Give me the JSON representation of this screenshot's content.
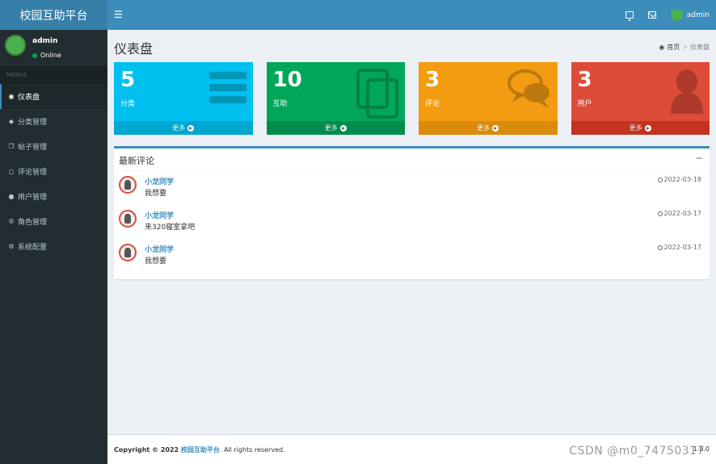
{
  "app": {
    "title": "校园互助平台"
  },
  "topbar": {
    "user_name": "admin",
    "icons": [
      "monitor-icon",
      "mail-icon"
    ]
  },
  "sidebar": {
    "user": {
      "name": "admin",
      "status": "Online"
    },
    "menu_header": "MENUS",
    "items": [
      {
        "label": "仪表盘",
        "icon": "dashboard-icon"
      },
      {
        "label": "分类管理",
        "icon": "tag-icon"
      },
      {
        "label": "帖子管理",
        "icon": "copy-icon"
      },
      {
        "label": "评论管理",
        "icon": "comment-icon"
      },
      {
        "label": "用户管理",
        "icon": "user-icon"
      },
      {
        "label": "角色管理",
        "icon": "registered-icon"
      },
      {
        "label": "系统配置",
        "icon": "gear-icon"
      }
    ]
  },
  "page": {
    "title": "仪表盘",
    "breadcrumb": {
      "home": "首页",
      "current": "仪表盘"
    }
  },
  "stats": [
    {
      "value": "5",
      "label": "分类",
      "more": "更多",
      "color": "#00c0ef",
      "icon": "bars-icon"
    },
    {
      "value": "10",
      "label": "互助",
      "more": "更多",
      "color": "#00a65a",
      "icon": "copy-icon"
    },
    {
      "value": "3",
      "label": "评论",
      "more": "更多",
      "color": "#f39c12",
      "icon": "comments-icon"
    },
    {
      "value": "3",
      "label": "用户",
      "more": "更多",
      "color": "#dd4b39",
      "icon": "user-icon"
    }
  ],
  "comments_panel": {
    "title": "最新评论",
    "collapse": "−",
    "items": [
      {
        "name": "小龙同学",
        "text": "我想要",
        "date": "2022-03-18"
      },
      {
        "name": "小龙同学",
        "text": "来320寝室拿吧",
        "date": "2022-03-17"
      },
      {
        "name": "小龙同学",
        "text": "我想要",
        "date": "2022-03-17"
      }
    ]
  },
  "footer": {
    "copyright_prefix": "Copyright © 2022 ",
    "link": "校园互助平台",
    "suffix": ". All rights reserved.",
    "version": "1.0.0"
  },
  "watermark": "CSDN @m0_74750317"
}
